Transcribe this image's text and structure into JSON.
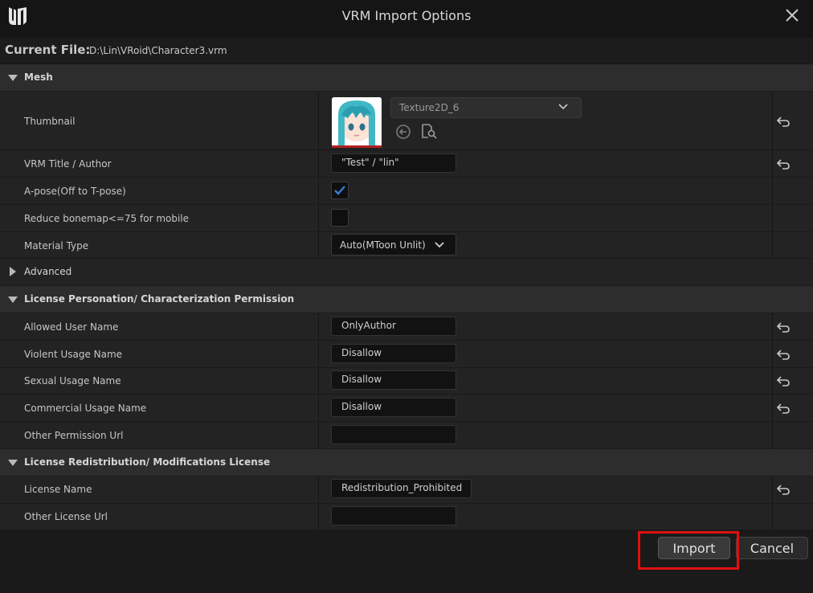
{
  "window": {
    "title": "VRM Import Options"
  },
  "current_file": {
    "label": "Current File:",
    "value": "D:\\Lin\\VRoid\\Character3.vrm"
  },
  "mesh": {
    "title": "Mesh",
    "thumbnail": {
      "label": "Thumbnail",
      "asset": "Texture2D_6"
    },
    "title_author": {
      "label": "VRM Title / Author",
      "value": "\"Test\" / \"lin\""
    },
    "apose": {
      "label": "A-pose(Off to T-pose)",
      "checked": true
    },
    "reduce_bonemap": {
      "label": "Reduce bonemap<=75 for mobile",
      "checked": false
    },
    "material_type": {
      "label": "Material Type",
      "value": "Auto(MToon Unlit)"
    }
  },
  "advanced": {
    "title": "Advanced"
  },
  "license_personation": {
    "title": "License Personation/ Characterization Permission",
    "rows": [
      {
        "label": "Allowed User Name",
        "value": "OnlyAuthor"
      },
      {
        "label": "Violent Usage Name",
        "value": "Disallow"
      },
      {
        "label": "Sexual Usage Name",
        "value": "Disallow"
      },
      {
        "label": "Commercial Usage Name",
        "value": "Disallow"
      },
      {
        "label": "Other Permission Url",
        "value": ""
      }
    ]
  },
  "license_redistribution": {
    "title": "License Redistribution/ Modifications License",
    "rows": [
      {
        "label": "License Name",
        "value": "Redistribution_Prohibited"
      },
      {
        "label": "Other License Url",
        "value": ""
      }
    ]
  },
  "buttons": {
    "import": "Import",
    "cancel": "Cancel"
  },
  "colors": {
    "highlight": "#dd1111",
    "checkbox_check": "#2f7fd8",
    "thumbnail_hair": "#3fb7c4"
  },
  "icons": [
    "unreal-logo-icon",
    "close-icon",
    "reset-arrow-icon",
    "chevron-down-icon",
    "use-selected-icon",
    "browse-asset-icon",
    "checkmark-icon"
  ]
}
